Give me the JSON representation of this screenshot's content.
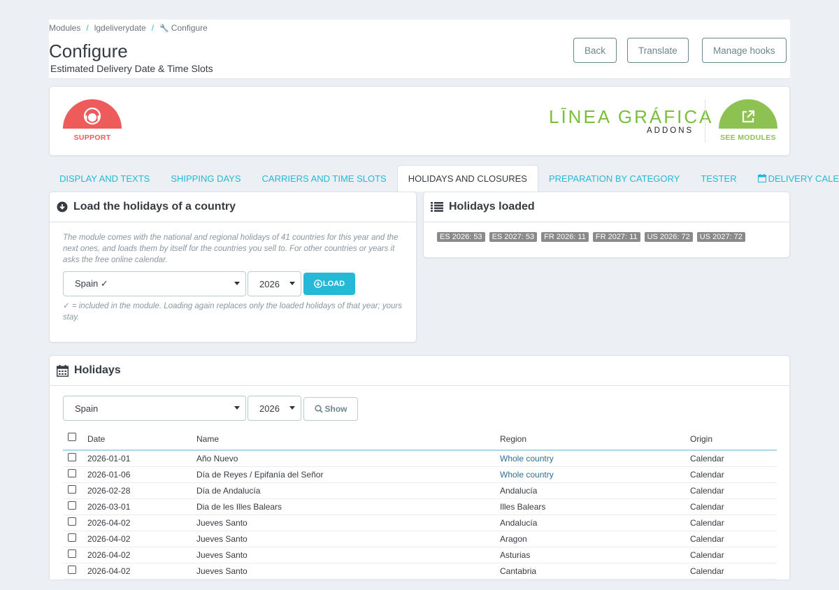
{
  "breadcrumb": {
    "items": [
      "Modules",
      "lgdeliverydate",
      "Configure"
    ]
  },
  "page": {
    "title": "Configure",
    "subtitle": "Estimated Delivery Date & Time Slots"
  },
  "toolbar": {
    "back": "Back",
    "translate": "Translate",
    "manage_hooks": "Manage hooks"
  },
  "banner": {
    "support_label": "SUPPORT",
    "brand_main": "LĪNEA GRÁFICA",
    "brand_sub": "ADDONS",
    "modules_label": "SEE MODULES"
  },
  "tabs": [
    {
      "label": "DISPLAY AND TEXTS"
    },
    {
      "label": "SHIPPING DAYS"
    },
    {
      "label": "CARRIERS AND TIME SLOTS"
    },
    {
      "label": "HOLIDAYS AND CLOSURES"
    },
    {
      "label": "PREPARATION BY CATEGORY"
    },
    {
      "label": "TESTER"
    },
    {
      "label": "DELIVERY CALENDAR"
    }
  ],
  "load_panel": {
    "title": "Load the holidays of a country",
    "help": "The module comes with the national and regional holidays of 41 countries for this year and the next ones, and loads them by itself for the countries you sell to. For other countries or years it asks the free online calendar.",
    "country": "Spain ✓",
    "year": "2026",
    "load_button": "LOAD",
    "note": "✓ = included in the module. Loading again replaces only the loaded holidays of that year; yours stay."
  },
  "loaded_panel": {
    "title": "Holidays loaded",
    "badges": [
      "ES 2026: 53",
      "ES 2027: 53",
      "FR 2026: 11",
      "FR 2027: 11",
      "US 2026: 72",
      "US 2027: 72"
    ]
  },
  "holidays_panel": {
    "title": "Holidays",
    "country": "Spain",
    "year": "2026",
    "show_button": "Show",
    "columns": {
      "date": "Date",
      "name": "Name",
      "region": "Region",
      "origin": "Origin"
    },
    "rows": [
      {
        "date": "2026-01-01",
        "name": "Año Nuevo",
        "region": "Whole country",
        "origin": "Calendar"
      },
      {
        "date": "2026-01-06",
        "name": "Día de Reyes / Epifanía del Señor",
        "region": "Whole country",
        "origin": "Calendar"
      },
      {
        "date": "2026-02-28",
        "name": "Día de Andalucía",
        "region": "Andalucía",
        "origin": "Calendar"
      },
      {
        "date": "2026-03-01",
        "name": "Dia de les Illes Balears",
        "region": "Illes Balears",
        "origin": "Calendar"
      },
      {
        "date": "2026-04-02",
        "name": "Jueves Santo",
        "region": "Andalucía",
        "origin": "Calendar"
      },
      {
        "date": "2026-04-02",
        "name": "Jueves Santo",
        "region": "Aragon",
        "origin": "Calendar"
      },
      {
        "date": "2026-04-02",
        "name": "Jueves Santo",
        "region": "Asturias",
        "origin": "Calendar"
      },
      {
        "date": "2026-04-02",
        "name": "Jueves Santo",
        "region": "Cantabria",
        "origin": "Calendar"
      }
    ]
  },
  "colors": {
    "accent": "#25b9d7",
    "support": "#ee5b5b",
    "modules": "#8dc253",
    "brand": "#7bbe3e"
  }
}
